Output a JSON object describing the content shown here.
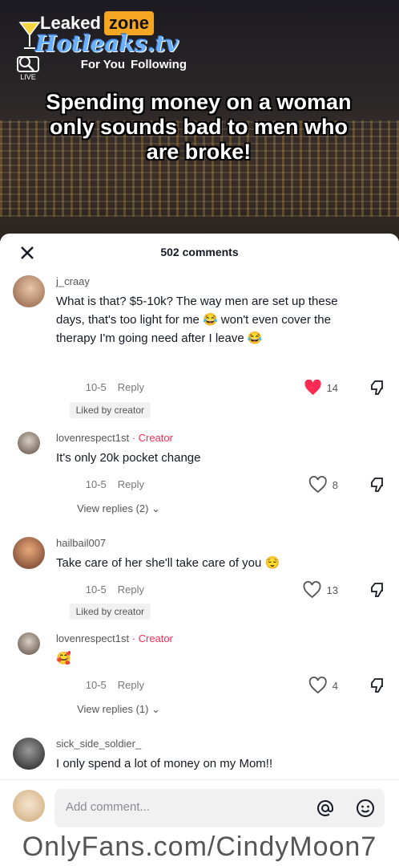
{
  "brand": {
    "leaked": "Leaked",
    "zone": "zone",
    "site": "Hotleaks.tv"
  },
  "tabs": {
    "following": "Following",
    "for_you": "For You",
    "live": "LIVE"
  },
  "video": {
    "caption": "Spending money on a woman only sounds bad to men who are broke!"
  },
  "comments_header": {
    "count_label": "502 comments"
  },
  "comments": [
    {
      "user": "j_craay",
      "text": "What is that? $5-10k? The way men are set up these days, that's too light for me 😂 won't even cover the therapy I'm going need after I leave 😂",
      "date": "10-5",
      "reply": "Reply",
      "likes": "14",
      "liked_by_creator": "Liked by creator",
      "heart_filled": true
    },
    {
      "user": "lovenrespect1st",
      "creator_tag": "· Creator",
      "text": "It's only 20k pocket change",
      "date": "10-5",
      "reply": "Reply",
      "likes": "8",
      "view_replies": "View replies (2)"
    },
    {
      "user": "hailbail007",
      "text": "Take care of her she'll take care of you 😌",
      "date": "10-5",
      "reply": "Reply",
      "likes": "13",
      "liked_by_creator": "Liked by creator"
    },
    {
      "user": "lovenrespect1st",
      "creator_tag": "· Creator",
      "text": "🥰",
      "date": "10-5",
      "reply": "Reply",
      "likes": "4",
      "view_replies": "View replies (1)"
    },
    {
      "user": "sick_side_soldier_",
      "text": "I only spend a lot of money on my Mom!!"
    }
  ],
  "composer": {
    "placeholder": "Add comment..."
  },
  "watermark": "OnlyFans.com/CindyMoon7",
  "colors": {
    "accent": "#fe2c55",
    "brand_orange": "#f5a623",
    "logo_blue": "#6ab0ff"
  },
  "icons": [
    "close-icon",
    "heart-icon",
    "dislike-icon",
    "emoji-icon",
    "mention-icon",
    "live-icon",
    "chevron-down-icon"
  ]
}
